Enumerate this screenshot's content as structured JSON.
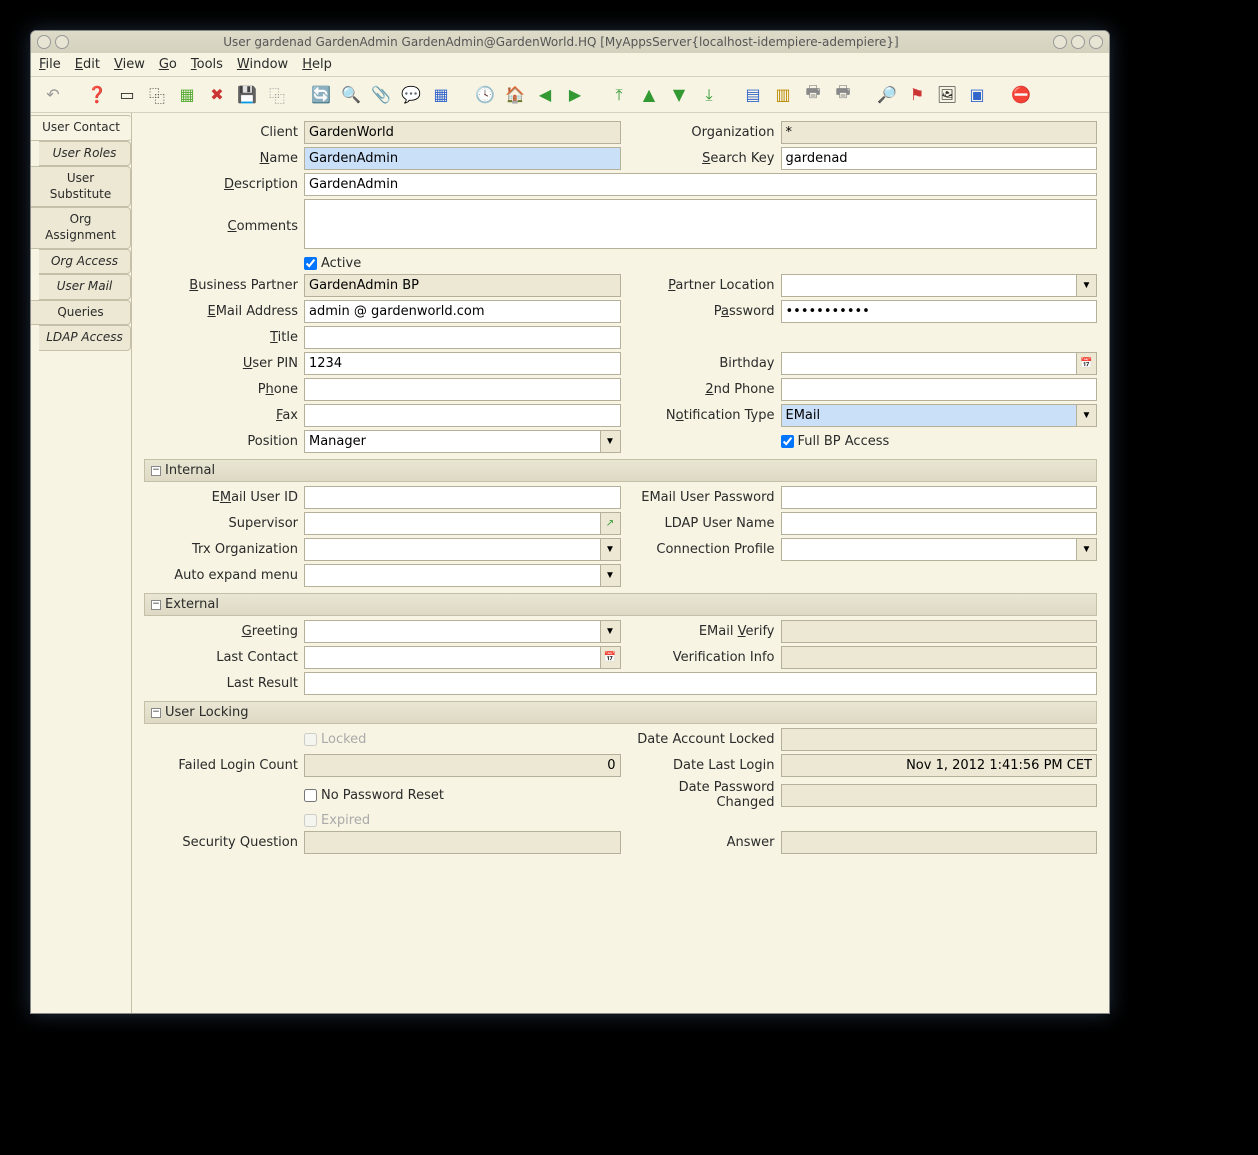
{
  "title": "User  gardenad  GardenAdmin  GardenAdmin@GardenWorld.HQ [MyAppsServer{localhost-idempiere-adempiere}]",
  "menu": {
    "file": "File",
    "edit": "Edit",
    "view": "View",
    "go": "Go",
    "tools": "Tools",
    "window": "Window",
    "help": "Help"
  },
  "tabs": {
    "user_contact": "User Contact",
    "user_roles": "User Roles",
    "user_substitute": "User Substitute",
    "org_assignment": "Org Assignment",
    "org_access": "Org Access",
    "user_mail": "User Mail",
    "queries": "Queries",
    "ldap_access": "LDAP Access"
  },
  "labels": {
    "client": "Client",
    "organization": "Organization",
    "name": "Name",
    "search_key": "Search Key",
    "description": "Description",
    "comments": "Comments",
    "active": "Active",
    "business_partner": "Business Partner",
    "partner_location": "Partner Location",
    "email_address": "EMail Address",
    "password": "Password",
    "title": "Title",
    "user_pin": "User PIN",
    "birthday": "Birthday",
    "phone": "Phone",
    "phone2": "2nd Phone",
    "fax": "Fax",
    "notification_type": "Notification Type",
    "position": "Position",
    "full_bp": "Full BP Access",
    "internal": "Internal",
    "email_user_id": "EMail User ID",
    "email_user_pw": "EMail User Password",
    "supervisor": "Supervisor",
    "ldap_user": "LDAP User Name",
    "trx_org": "Trx Organization",
    "conn_profile": "Connection Profile",
    "auto_expand": "Auto expand menu",
    "external": "External",
    "greeting": "Greeting",
    "email_verify": "EMail Verify",
    "last_contact": "Last Contact",
    "verif_info": "Verification Info",
    "last_result": "Last Result",
    "user_locking": "User Locking",
    "locked": "Locked",
    "date_locked": "Date Account Locked",
    "failed_login": "Failed Login Count",
    "date_last_login": "Date Last Login",
    "no_pw_reset": "No Password Reset",
    "date_pw_changed": "Date Password Changed",
    "expired": "Expired",
    "sec_question": "Security Question",
    "answer": "Answer"
  },
  "values": {
    "client": "GardenWorld",
    "organization": "*",
    "name": "GardenAdmin",
    "search_key": "gardenad",
    "description": "GardenAdmin",
    "comments": "",
    "active": true,
    "business_partner": "GardenAdmin BP",
    "partner_location": "",
    "email_address": "admin @ gardenworld.com",
    "password": "•••••••••••",
    "title": "",
    "user_pin": "1234",
    "birthday": "",
    "phone": "",
    "phone2": "",
    "fax": "",
    "notification_type": "EMail",
    "position": "Manager",
    "full_bp": true,
    "email_user_id": "",
    "email_user_pw": "",
    "supervisor": "",
    "ldap_user": "",
    "trx_org": "",
    "conn_profile": "",
    "auto_expand": "",
    "greeting": "",
    "email_verify": "",
    "last_contact": "",
    "verif_info": "",
    "last_result": "",
    "locked": false,
    "date_locked": "",
    "failed_login": "0",
    "date_last_login": "Nov 1, 2012 1:41:56 PM CET",
    "no_pw_reset": false,
    "date_pw_changed": "",
    "expired": false,
    "sec_question": "",
    "answer": ""
  }
}
